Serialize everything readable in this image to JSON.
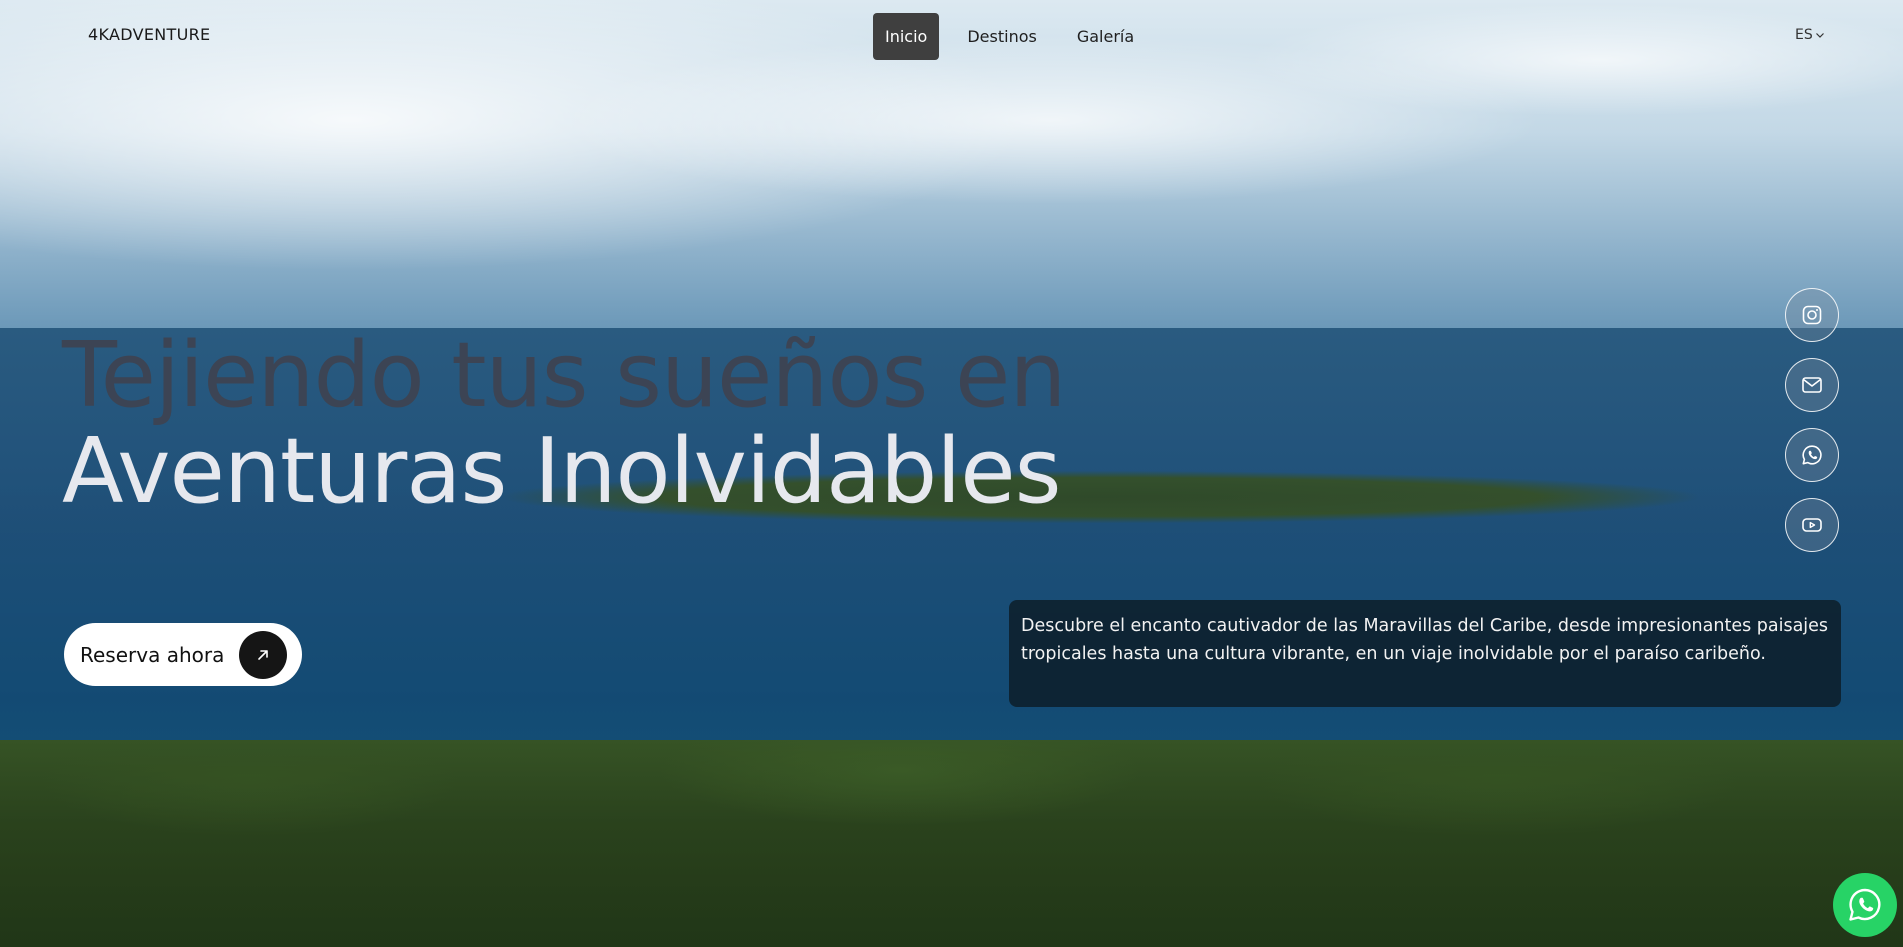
{
  "brand": {
    "logo_text": "4KADVENTURE"
  },
  "nav": {
    "items": [
      {
        "label": "Inicio",
        "active": true
      },
      {
        "label": "Destinos",
        "active": false
      },
      {
        "label": "Galería",
        "active": false
      }
    ]
  },
  "language": {
    "selected": "ES",
    "icon": "chevron-down-icon"
  },
  "hero": {
    "headline_line1": "Tejiendo tus sueños en",
    "headline_line2": "Aventuras Inolvidables",
    "cta_label": "Reserva ahora",
    "cta_icon": "arrow-up-right-icon",
    "description": "Descubre el encanto cautivador de las Maravillas del Caribe, desde impresionantes paisajes tropicales hasta una cultura vibrante, en un viaje inolvidable por el paraíso caribeño."
  },
  "social": [
    {
      "name": "instagram",
      "icon": "instagram-icon"
    },
    {
      "name": "email",
      "icon": "mail-icon"
    },
    {
      "name": "whatsapp",
      "icon": "whatsapp-icon"
    },
    {
      "name": "youtube",
      "icon": "youtube-icon"
    }
  ],
  "floating_whatsapp": {
    "icon": "whatsapp-icon",
    "color": "#27d366"
  },
  "colors": {
    "headline_dark": "#3c4454",
    "headline_light": "#e6e8ee",
    "nav_active_bg": "#3f3f3f"
  }
}
